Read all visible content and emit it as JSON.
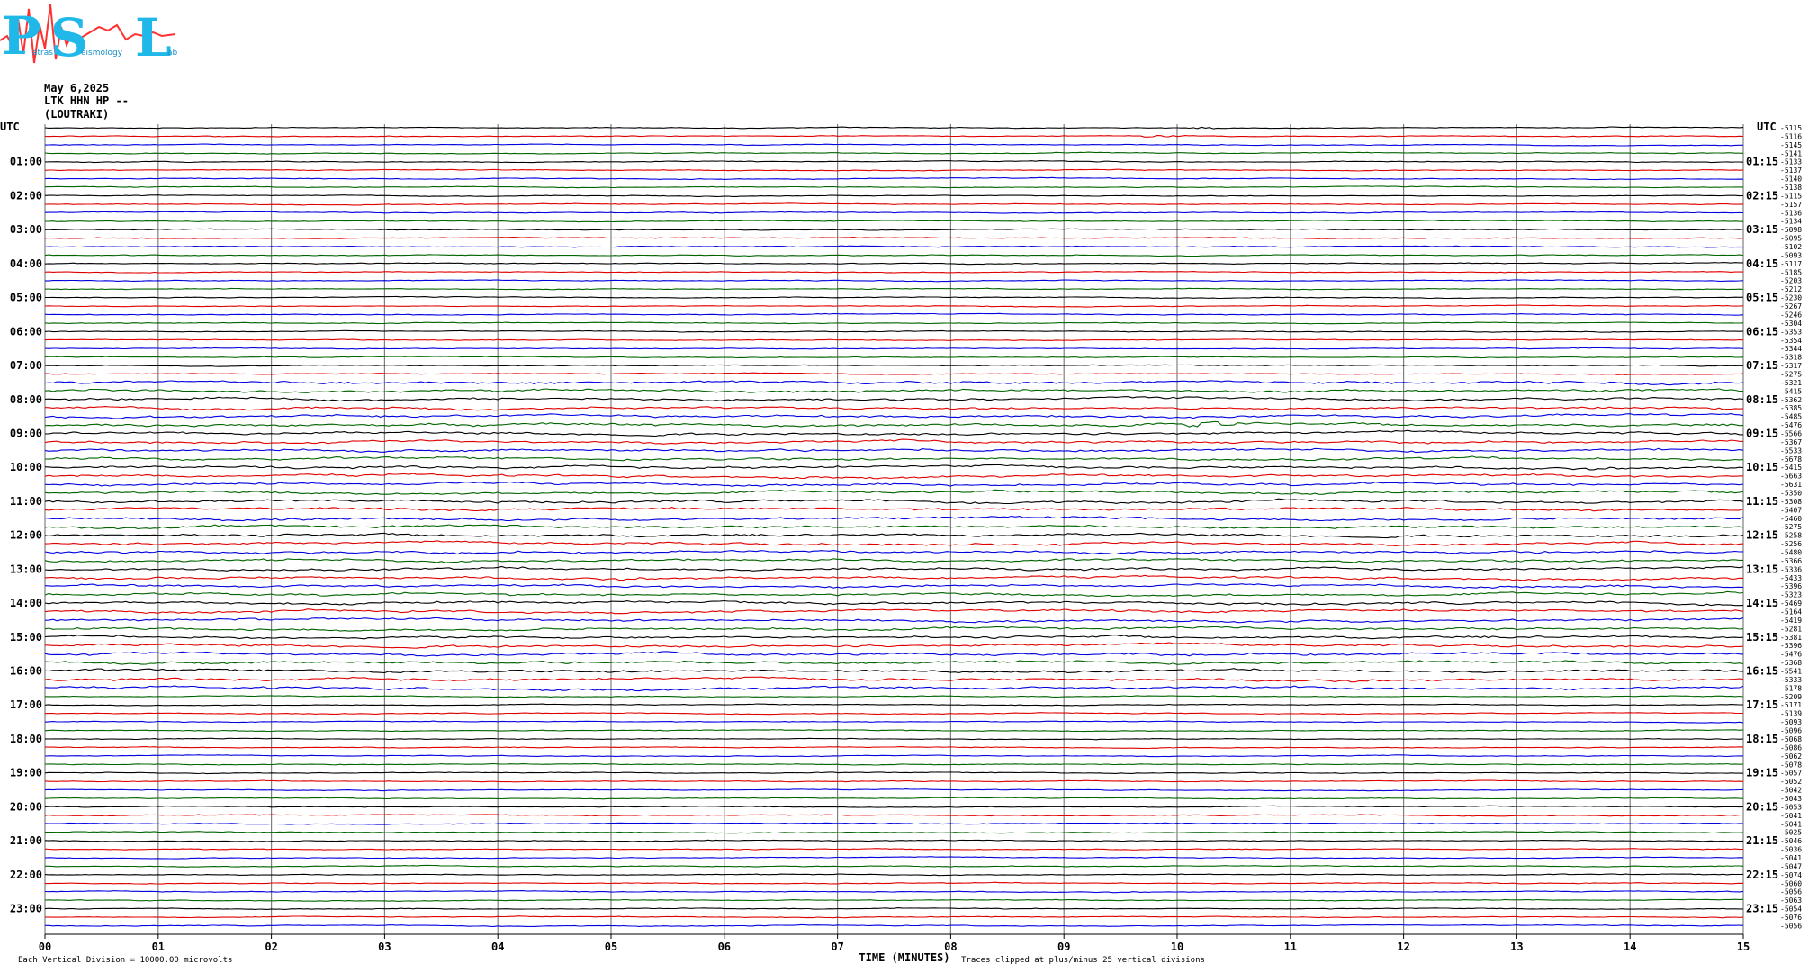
{
  "logo": {
    "big_letters": [
      "P",
      "S",
      "L"
    ],
    "small_words": [
      "atras",
      "eismology",
      "ab"
    ]
  },
  "header": {
    "date": "May 6,2025",
    "station": "LTK HHN HP --",
    "location": "(LOUTRAKI)"
  },
  "footer": {
    "division_note": "Each Vertical Division = 10000.00 microvolts",
    "xlabel": "TIME (MINUTES)",
    "clip_note": "Traces clipped at plus/minus 25 vertical divisions"
  },
  "chart_data": {
    "type": "line",
    "title": "",
    "xlabel": "TIME (MINUTES)",
    "ylabel": "UTC",
    "xlim": [
      0,
      15
    ],
    "x_ticks": [
      "00",
      "01",
      "02",
      "03",
      "04",
      "05",
      "06",
      "07",
      "08",
      "09",
      "10",
      "11",
      "12",
      "13",
      "14",
      "15"
    ],
    "left_axis_label": "UTC",
    "right_axis_label": "UTC",
    "left_hour_labels": [
      "01:00",
      "02:00",
      "03:00",
      "04:00",
      "05:00",
      "06:00",
      "07:00",
      "08:00",
      "09:00",
      "10:00",
      "11:00",
      "12:00",
      "13:00",
      "14:00",
      "15:00",
      "16:00",
      "17:00",
      "18:00",
      "19:00",
      "20:00",
      "21:00",
      "22:00",
      "23:00"
    ],
    "right_hour_labels": [
      "01:15",
      "02:15",
      "03:15",
      "04:15",
      "05:15",
      "06:15",
      "07:15",
      "08:15",
      "09:15",
      "10:15",
      "11:15",
      "12:15",
      "13:15",
      "14:15",
      "15:15",
      "16:15",
      "17:15",
      "18:15",
      "19:15",
      "20:15",
      "21:15",
      "22:15",
      "23:15"
    ],
    "trace_colors": [
      "#000000",
      "#e00000",
      "#0000e0",
      "#006400"
    ],
    "grid_color": "#808080",
    "right_offsets": [
      "-5115",
      "-5116",
      "-5145",
      "-5141",
      "-5133",
      "-5137",
      "-5140",
      "-5138",
      "-5115",
      "-5157",
      "-5136",
      "-5134",
      "-5098",
      "-5095",
      "-5102",
      "-5093",
      "-5117",
      "-5185",
      "-5203",
      "-5212",
      "-5230",
      "-5267",
      "-5246",
      "-5304",
      "-5353",
      "-5354",
      "-5344",
      "-5318",
      "-5317",
      "-5275",
      "-5321",
      "-5415",
      "-5362",
      "-5385",
      "-5485",
      "-5476",
      "-5566",
      "-5367",
      "-5533",
      "-5678",
      "-5415",
      "-5663",
      "-5631",
      "-5350",
      "-5308",
      "-5407",
      "-5460",
      "-5275",
      "-5258",
      "-5256",
      "-5480",
      "-5366",
      "-5336",
      "-5433",
      "-5396",
      "-5323",
      "-5469",
      "-5164",
      "-5419",
      "-5281",
      "-5381",
      "-5396",
      "-5476",
      "-5368",
      "-5541",
      "-5333",
      "-5178",
      "-5209",
      "-5171",
      "-5139",
      "-5093",
      "-5096",
      "-5068",
      "-5086",
      "-5062",
      "-5078",
      "-5057",
      "-5052",
      "-5042",
      "-5043",
      "-5053",
      "-5041",
      "-5041",
      "-5025",
      "-5046",
      "-5036",
      "-5041",
      "-5047",
      "-5074",
      "-5060",
      "-5056",
      "-5063",
      "-5054",
      "-5076",
      "-5056"
    ],
    "events": [
      {
        "trace_index": 35,
        "minute_start": 10.05,
        "minute_end": 10.6,
        "amplitude": 4.5
      },
      {
        "trace_index": 1,
        "minute_start": 9.7,
        "minute_end": 10.1,
        "amplitude": 1.6
      },
      {
        "trace_index": 0,
        "minute_start": 10.1,
        "minute_end": 10.4,
        "amplitude": 1.4
      }
    ]
  }
}
